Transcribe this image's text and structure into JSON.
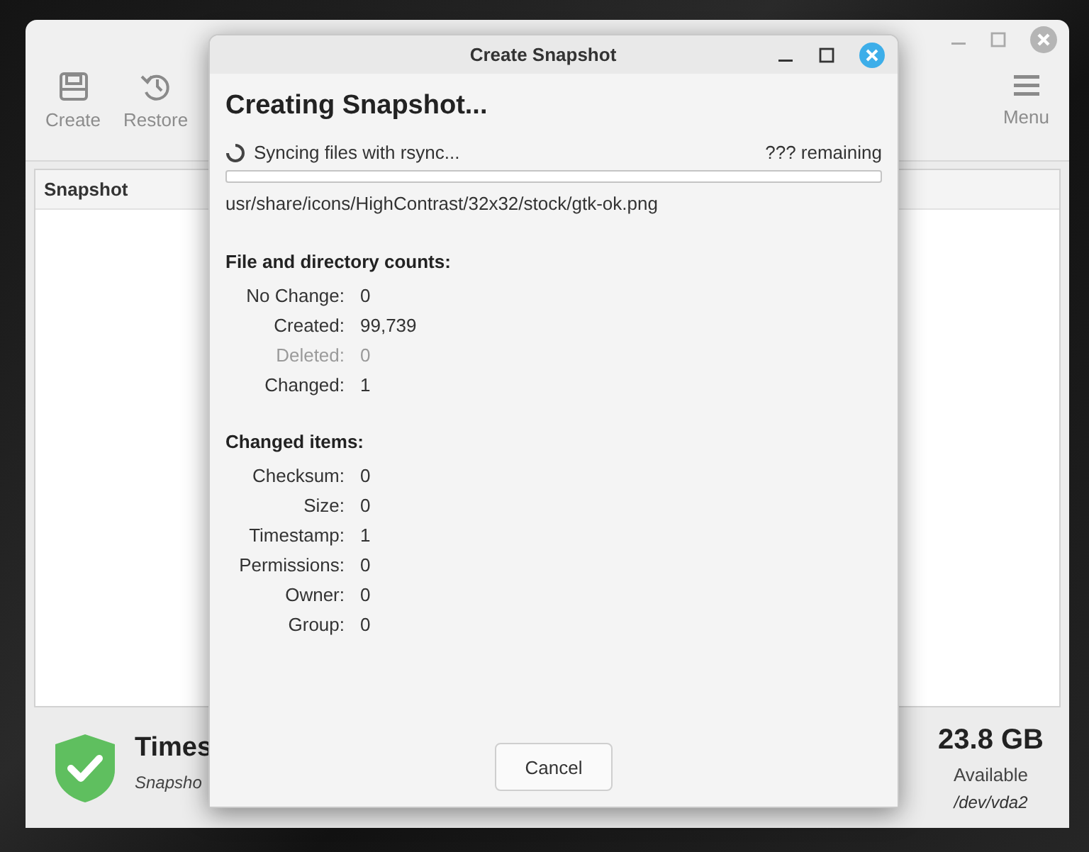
{
  "main_window": {
    "window_controls": [
      {
        "kind": "minimize"
      },
      {
        "kind": "maximize"
      },
      {
        "kind": "close"
      }
    ],
    "toolbar": [
      {
        "kind": "save",
        "label": "Create"
      },
      {
        "kind": "history",
        "label": "Restore"
      }
    ],
    "menu_button": {
      "label": "Menu"
    },
    "list": {
      "columns": [
        "Snapshot"
      ]
    },
    "status": {
      "title": "Times",
      "subtitle": "Snapsho",
      "size": "23.8 GB",
      "size_label": "Available",
      "device": "/dev/vda2"
    }
  },
  "dialog": {
    "title": "Create Snapshot",
    "window_controls": [
      {
        "kind": "minimize"
      },
      {
        "kind": "maximize"
      },
      {
        "kind": "close"
      }
    ],
    "heading": "Creating Snapshot...",
    "status": "Syncing files with rsync...",
    "remaining": "??? remaining",
    "progress": {
      "level": 0
    },
    "current_file": "usr/share/icons/HighContrast/32x32/stock/gtk-ok.png",
    "sections": [
      {
        "title": "File and directory counts:",
        "rows": [
          {
            "label": "No Change:",
            "value": "0",
            "disabled": false
          },
          {
            "label": "Created:",
            "value": "99,739",
            "disabled": false
          },
          {
            "label": "Deleted:",
            "value": "0",
            "disabled": true
          },
          {
            "label": "Changed:",
            "value": "1",
            "disabled": false
          }
        ]
      },
      {
        "title": "Changed items:",
        "rows": [
          {
            "label": "Checksum:",
            "value": "0",
            "disabled": false
          },
          {
            "label": "Size:",
            "value": "0",
            "disabled": false
          },
          {
            "label": "Timestamp:",
            "value": "1",
            "disabled": false
          },
          {
            "label": "Permissions:",
            "value": "0",
            "disabled": false
          },
          {
            "label": "Owner:",
            "value": "0",
            "disabled": false
          },
          {
            "label": "Group:",
            "value": "0",
            "disabled": false
          }
        ]
      }
    ],
    "buttons": [
      {
        "label": "Cancel"
      }
    ]
  }
}
